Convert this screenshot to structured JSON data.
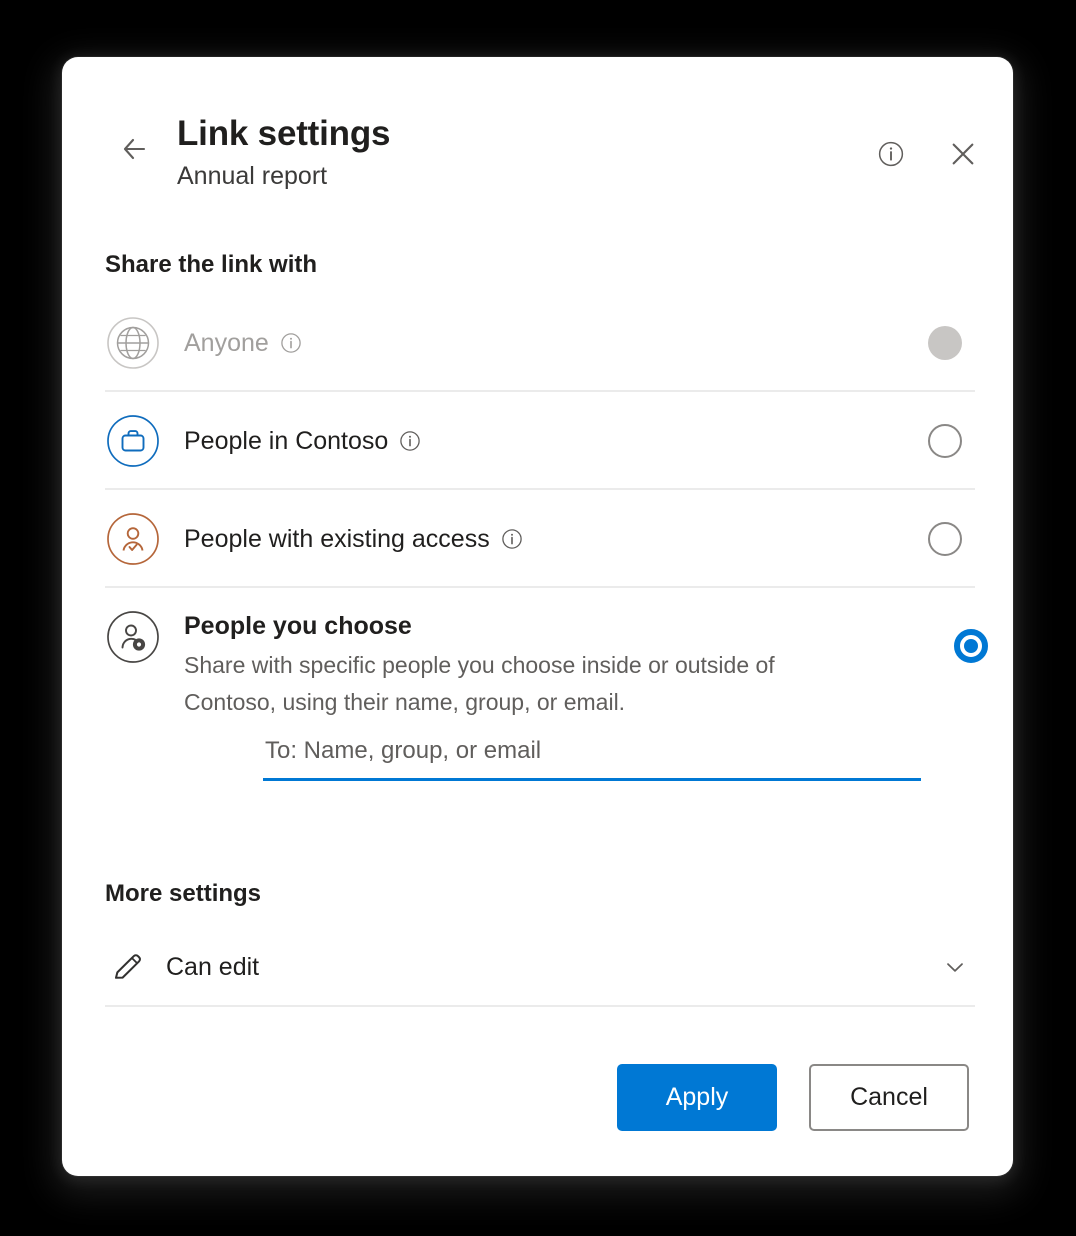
{
  "dialog": {
    "title": "Link settings",
    "subtitle": "Annual report",
    "back_icon": "arrow-left-icon",
    "info_icon": "info-circle-icon",
    "close_icon": "close-icon"
  },
  "share_section": {
    "heading": "Share the link with",
    "options": [
      {
        "label": "Anyone",
        "icon": "globe-icon",
        "info_icon": "info-circle-icon",
        "state": "disabled",
        "selected": false
      },
      {
        "label": "People in Contoso",
        "icon": "briefcase-icon",
        "info_icon": "info-circle-icon",
        "state": "enabled",
        "selected": false
      },
      {
        "label": "People with existing access",
        "icon": "person-check-icon",
        "info_icon": "info-circle-icon",
        "state": "enabled",
        "selected": false
      },
      {
        "label": "People you choose",
        "description": "Share with specific people you choose inside or outside of Contoso, using their name, group, or email.",
        "icon": "person-settings-icon",
        "state": "enabled",
        "selected": true
      }
    ]
  },
  "recipient_field": {
    "placeholder": "To: Name, group, or email",
    "value": ""
  },
  "more_settings": {
    "heading": "More settings",
    "permission_label": "Can edit",
    "permission_icon": "pencil-icon",
    "chevron_icon": "chevron-down-icon"
  },
  "footer": {
    "apply_label": "Apply",
    "cancel_label": "Cancel"
  },
  "colors": {
    "accent": "#0078d4",
    "text_primary": "#201f1e",
    "text_secondary": "#605e5c",
    "text_disabled": "#a19f9d",
    "divider": "#ebebeb",
    "icon_contoso": "#0f6cbd",
    "icon_existing_access": "#b5663a",
    "backdrop": "#000000"
  }
}
